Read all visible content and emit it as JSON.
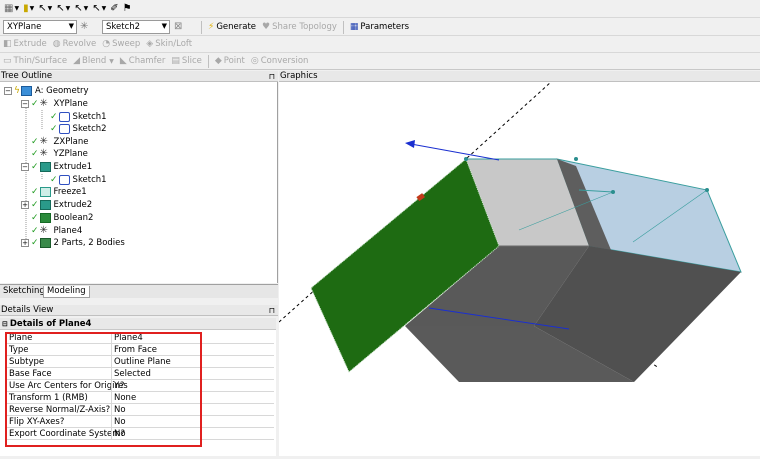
{
  "toolbar2": {
    "plane_combo": "XYPlane",
    "sketch_combo": "Sketch2",
    "generate": "Generate",
    "share_topology": "Share Topology",
    "parameters": "Parameters"
  },
  "toolbar3": {
    "extrude": "Extrude",
    "revolve": "Revolve",
    "sweep": "Sweep",
    "skin_loft": "Skin/Loft"
  },
  "toolbar4": {
    "thin_surface": "Thin/Surface",
    "blend": "Blend",
    "chamfer": "Chamfer",
    "slice": "Slice",
    "point": "Point",
    "conversion": "Conversion"
  },
  "panels": {
    "tree_outline": "Tree Outline",
    "graphics": "Graphics",
    "details_view": "Details View",
    "pin_icon": "pin-icon"
  },
  "tree": [
    {
      "label": "A: Geometry",
      "icon": "geometry-icon"
    },
    {
      "label": "XYPlane",
      "icon": "plane-axes-icon"
    },
    {
      "label": "Sketch1",
      "icon": "sketch-icon"
    },
    {
      "label": "Sketch2",
      "icon": "sketch-icon"
    },
    {
      "label": "ZXPlane",
      "icon": "plane-axes-icon"
    },
    {
      "label": "YZPlane",
      "icon": "plane-axes-icon"
    },
    {
      "label": "Extrude1",
      "icon": "extrude-icon"
    },
    {
      "label": "Sketch1",
      "icon": "sketch-icon"
    },
    {
      "label": "Freeze1",
      "icon": "freeze-icon"
    },
    {
      "label": "Extrude2",
      "icon": "extrude-icon"
    },
    {
      "label": "Boolean2",
      "icon": "boolean-icon"
    },
    {
      "label": "Plane4",
      "icon": "plane-axes-icon"
    },
    {
      "label": "2 Parts, 2 Bodies",
      "icon": "parts-icon"
    }
  ],
  "tabs": {
    "sketching": "Sketching",
    "modeling": "Modeling"
  },
  "details": {
    "header": "Details of Plane4",
    "rows": [
      {
        "key": "Plane",
        "value": "Plane4"
      },
      {
        "key": "Type",
        "value": "From Face"
      },
      {
        "key": "Subtype",
        "value": "Outline Plane"
      },
      {
        "key": "Base Face",
        "value": "Selected"
      },
      {
        "key": "Use Arc Centers for Origin?",
        "value": "Yes"
      },
      {
        "key": "Transform 1 (RMB)",
        "value": "None"
      },
      {
        "key": "Reverse Normal/Z-Axis?",
        "value": "No"
      },
      {
        "key": "Flip XY-Axes?",
        "value": "No"
      },
      {
        "key": "Export Coordinate System?",
        "value": "No"
      }
    ]
  },
  "colors": {
    "selected_face": "#1e6b12",
    "highlight_box": "#e0201f",
    "axis_blue": "#1a2fd0"
  }
}
